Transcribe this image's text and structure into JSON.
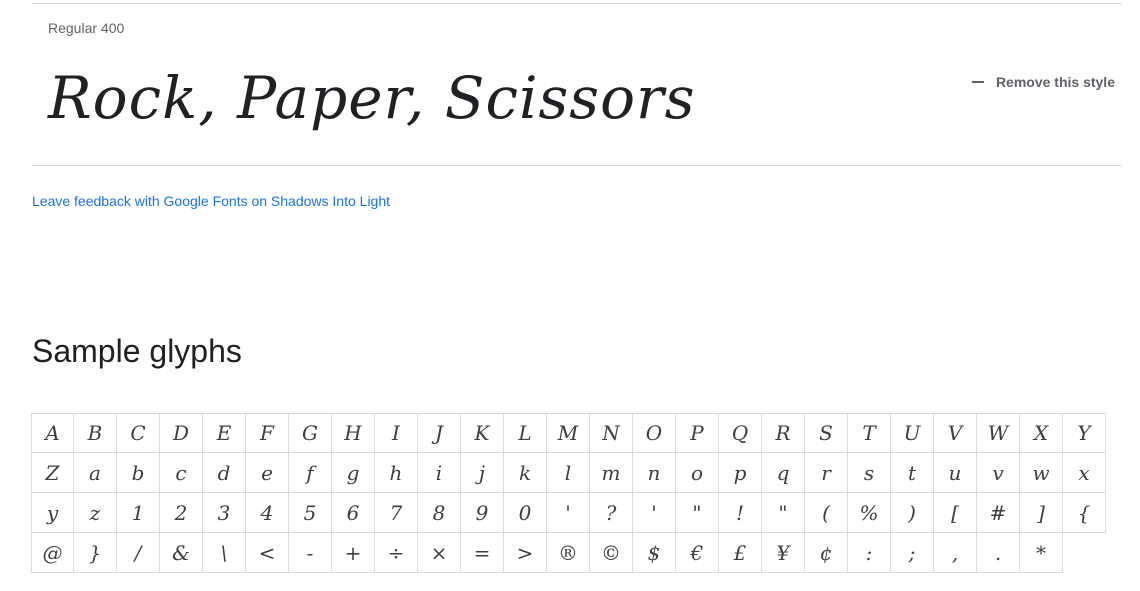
{
  "style": {
    "label": "Regular 400",
    "preview_text": "Rock, Paper, Scissors",
    "remove_label": "Remove this style"
  },
  "feedback_link": "Leave feedback with Google Fonts on Shadows Into Light",
  "glyphs": {
    "title": "Sample glyphs",
    "items": [
      "A",
      "B",
      "C",
      "D",
      "E",
      "F",
      "G",
      "H",
      "I",
      "J",
      "K",
      "L",
      "M",
      "N",
      "O",
      "P",
      "Q",
      "R",
      "S",
      "T",
      "U",
      "V",
      "W",
      "X",
      "Y",
      "Z",
      "a",
      "b",
      "c",
      "d",
      "e",
      "f",
      "g",
      "h",
      "i",
      "j",
      "k",
      "l",
      "m",
      "n",
      "o",
      "p",
      "q",
      "r",
      "s",
      "t",
      "u",
      "v",
      "w",
      "x",
      "y",
      "z",
      "1",
      "2",
      "3",
      "4",
      "5",
      "6",
      "7",
      "8",
      "9",
      "0",
      "'",
      "?",
      "'",
      "\"",
      "!",
      "\"",
      "(",
      "%",
      ")",
      "[",
      "#",
      "]",
      "{",
      "@",
      "}",
      "/",
      "&",
      "\\",
      "<",
      "-",
      "+",
      "÷",
      "×",
      "=",
      ">",
      "®",
      "©",
      "$",
      "€",
      "£",
      "¥",
      "¢",
      ":",
      ";",
      ",",
      ".",
      "*"
    ]
  }
}
